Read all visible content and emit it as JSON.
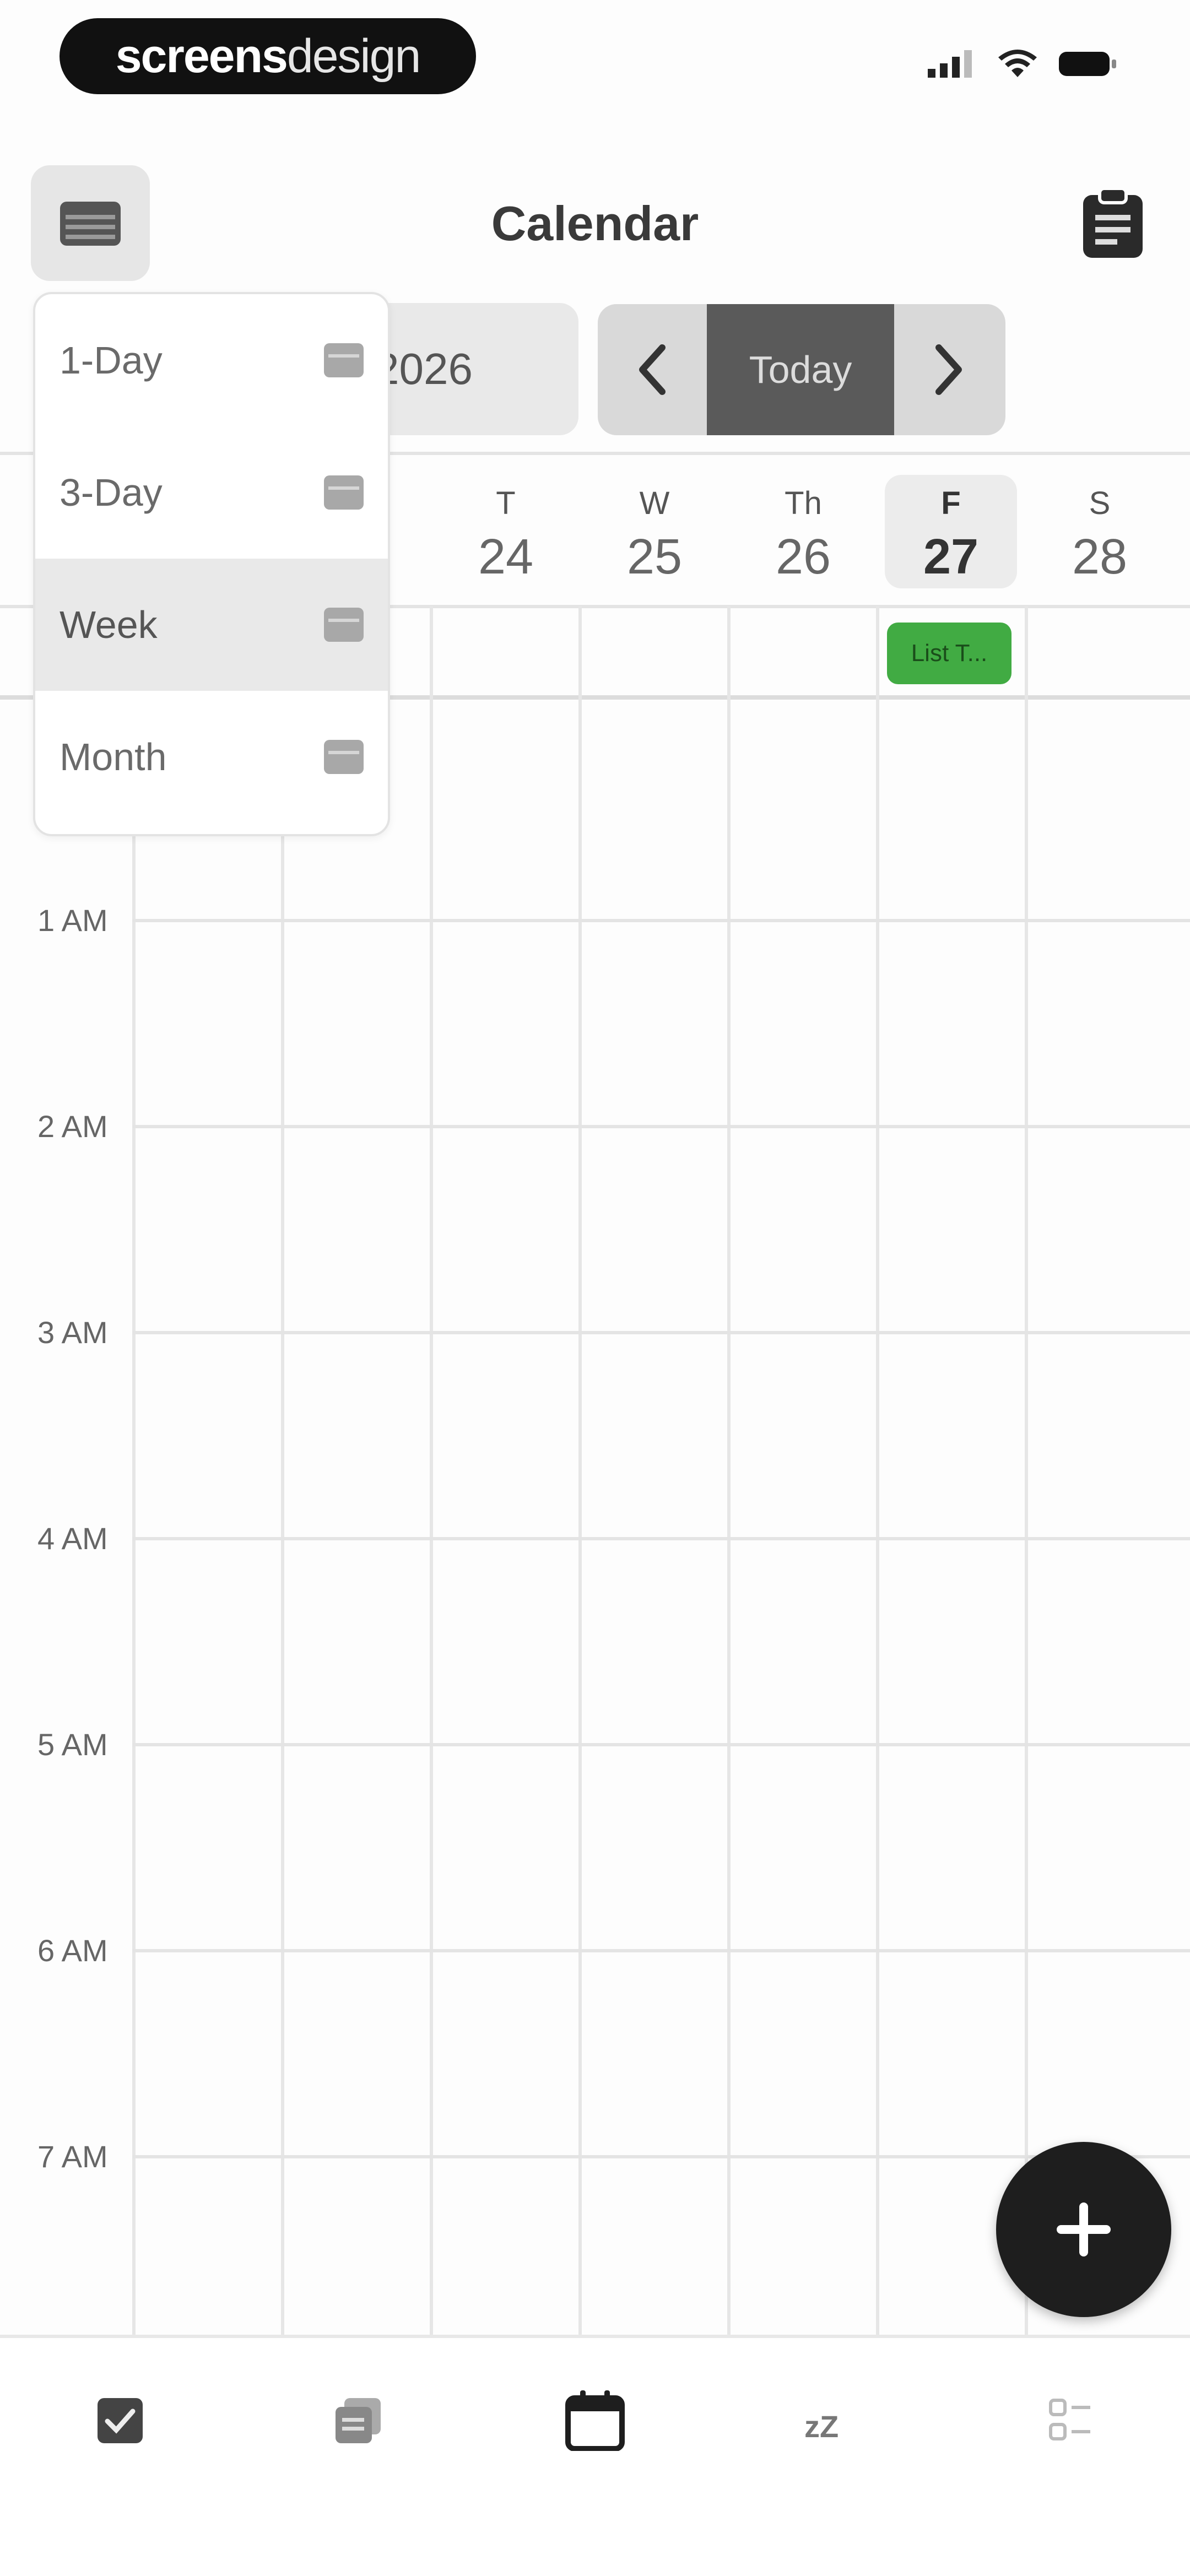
{
  "status_bar": {
    "brand_bold": "screens",
    "brand_light": "design"
  },
  "header": {
    "title": "Calendar"
  },
  "controls": {
    "month_label": "2026",
    "today_label": "Today"
  },
  "view_menu": {
    "items": [
      {
        "label": "1-Day"
      },
      {
        "label": "3-Day"
      },
      {
        "label": "Week",
        "active": true
      },
      {
        "label": "Month"
      }
    ]
  },
  "week": {
    "days": [
      {
        "letter": "T",
        "number": "24"
      },
      {
        "letter": "W",
        "number": "25"
      },
      {
        "letter": "Th",
        "number": "26"
      },
      {
        "letter": "F",
        "number": "27",
        "selected": true
      },
      {
        "letter": "S",
        "number": "28"
      }
    ]
  },
  "all_day_event": {
    "label": "List T...",
    "color": "#41ab43"
  },
  "hours": [
    "1 AM",
    "2 AM",
    "3 AM",
    "4 AM",
    "5 AM",
    "6 AM",
    "7 AM"
  ],
  "colors": {
    "accent": "#41ab43",
    "fab": "#1e1e1e",
    "today_button": "#5a5a5a"
  },
  "icons": {
    "menu": "calendar-view-icon",
    "clipboard": "clipboard-icon",
    "fab": "plus-icon",
    "tabs": [
      "checklist-icon",
      "notes-icon",
      "calendar-icon",
      "sleep-icon",
      "habits-icon"
    ]
  }
}
